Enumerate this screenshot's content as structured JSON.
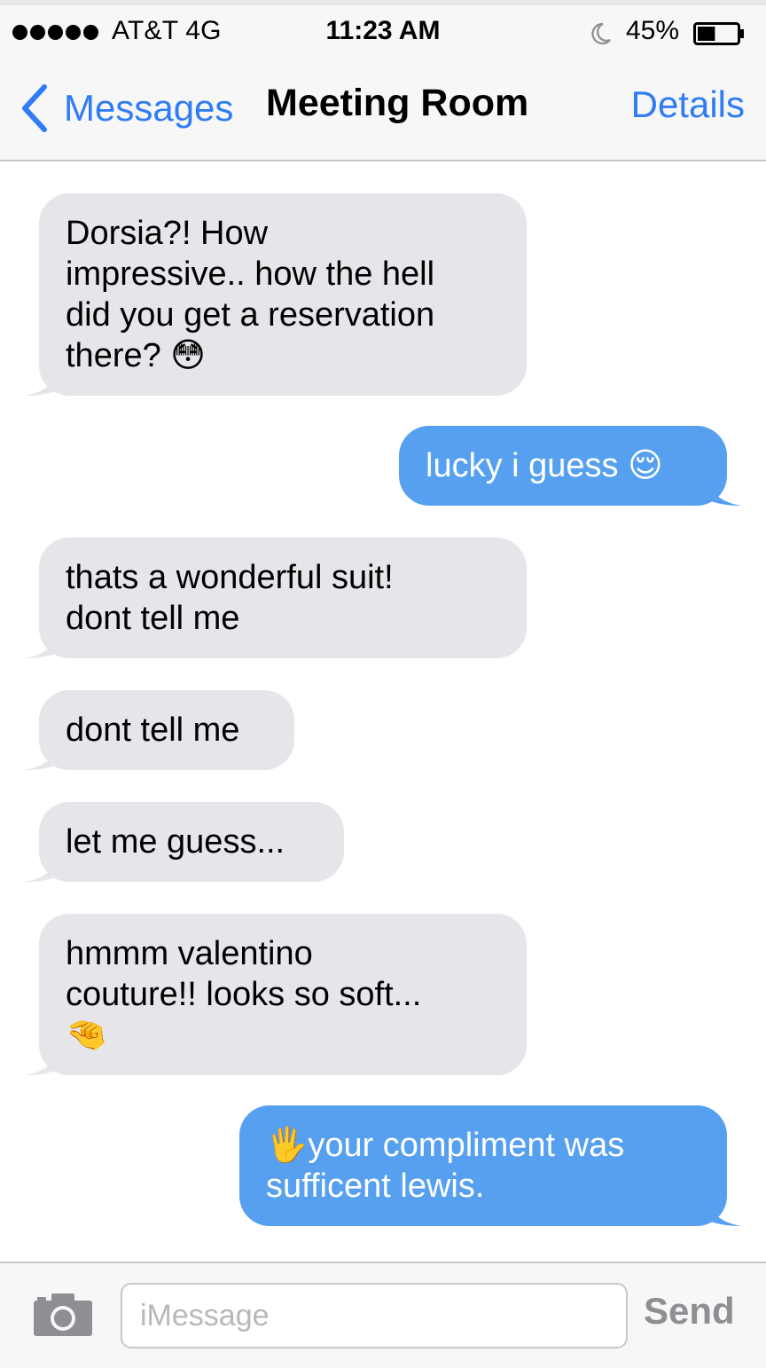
{
  "status_bar": {
    "carrier": "AT&T  4G",
    "time": "11:23 AM",
    "battery_percent": "45%",
    "battery_level": 0.45,
    "signal_bars": 5
  },
  "nav": {
    "back_label": "Messages",
    "title": "Meeting Room",
    "details_label": "Details"
  },
  "colors": {
    "accent": "#2f7cf6",
    "incoming_bubble": "#e5e5ea",
    "outgoing_bubble": "#56a0ef"
  },
  "messages": [
    {
      "direction": "incoming",
      "text": "Dorsia?! How\nimpressive.. how the hell\ndid you get a reservation\nthere? 😳"
    },
    {
      "direction": "outgoing",
      "text": "lucky i guess 😌"
    },
    {
      "direction": "incoming",
      "text": "thats a wonderful suit!\ndont tell me"
    },
    {
      "direction": "incoming",
      "text": "dont tell me"
    },
    {
      "direction": "incoming",
      "text": "let me guess..."
    },
    {
      "direction": "incoming",
      "text": "hmmm valentino\ncouture!! looks so soft...\n🤏"
    },
    {
      "direction": "outgoing",
      "text": "🖐your compliment was\nsufficent lewis."
    }
  ],
  "input": {
    "placeholder": "iMessage",
    "value": "",
    "send_label": "Send"
  },
  "icons": [
    "chevron-left-icon",
    "moon-icon",
    "battery-icon",
    "camera-icon"
  ]
}
